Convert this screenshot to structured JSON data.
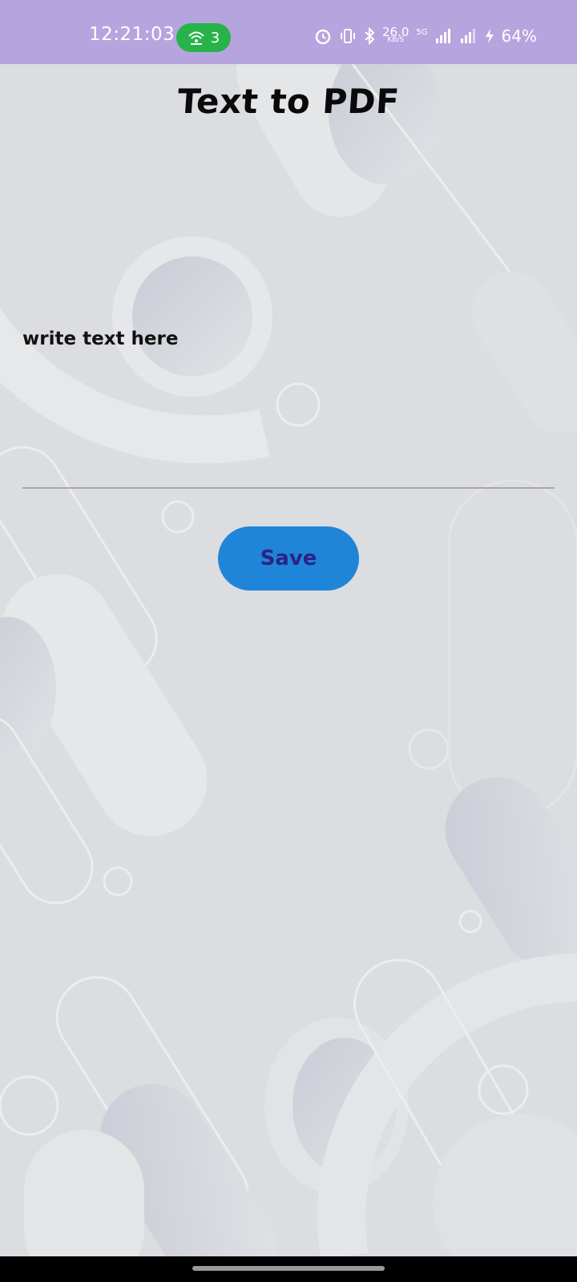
{
  "status_bar": {
    "time": "12:21:03",
    "hotspot_count": "3",
    "speed_value": "26.0",
    "speed_unit": "KB/S",
    "network": "5G",
    "battery": "64%"
  },
  "app": {
    "title": "Text to PDF"
  },
  "input": {
    "placeholder": "write text here",
    "value": ""
  },
  "actions": {
    "save_label": "Save"
  },
  "colors": {
    "status_bar": "#b6a4df",
    "hotspot": "#27b34a",
    "save_button": "#1f85d8",
    "save_text": "#2b2386",
    "background": "#dcdde0"
  },
  "icons": {
    "hotspot": "hotspot-icon",
    "alarm": "alarm-icon",
    "vibrate": "vibrate-icon",
    "bluetooth": "bluetooth-icon",
    "signal": "signal-icon",
    "battery": "battery-charging-icon"
  }
}
